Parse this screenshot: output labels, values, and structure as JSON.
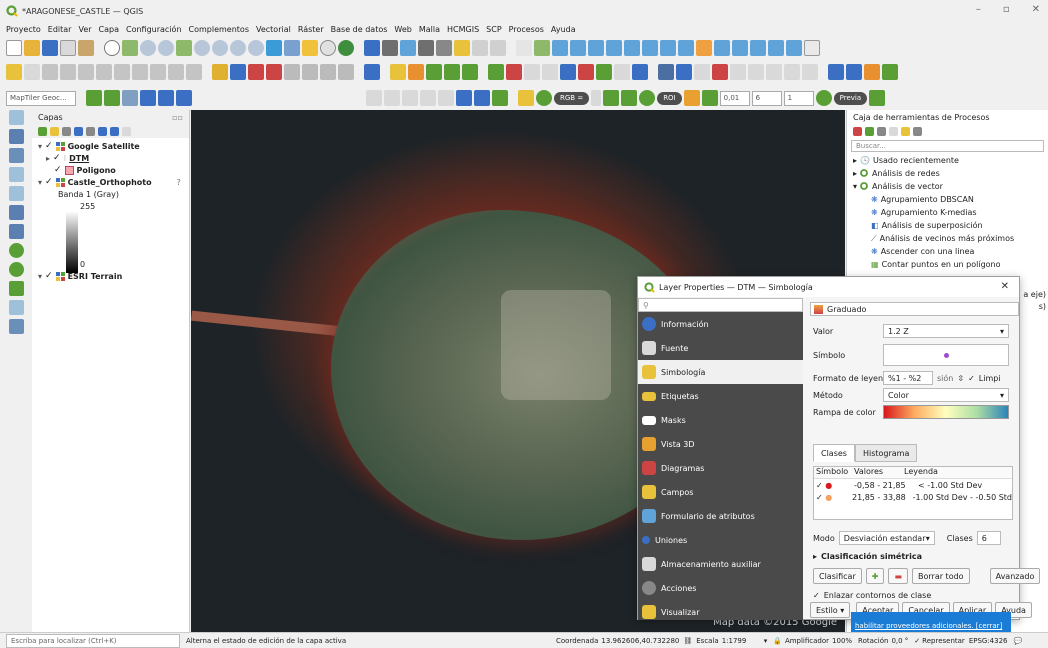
{
  "window": {
    "title": "*ARAGONESE_CASTLE — QGIS",
    "controls": [
      "–",
      "▫",
      "✕"
    ]
  },
  "menu": [
    "Proyecto",
    "Editar",
    "Ver",
    "Capa",
    "Configuración",
    "Complementos",
    "Vectorial",
    "Ráster",
    "Base de datos",
    "Web",
    "Malla",
    "HCMGIS",
    "SCP",
    "Procesos",
    "Ayuda"
  ],
  "toolbar3": {
    "maptiler": "MapTiler Geoc...",
    "rgb": "RGB =",
    "roi": "ROI",
    "dist1": "0,01",
    "dist2": "6",
    "dist3": "1",
    "preview": "Previa"
  },
  "layers": {
    "title": "Capas",
    "items": [
      {
        "name": "Google Satellite",
        "bold": true
      },
      {
        "name": "DTM",
        "bold": true
      },
      {
        "name": "Poligono",
        "bold": true
      },
      {
        "name": "Castle_Orthophoto",
        "bold": true
      },
      {
        "name": "Banda 1 (Gray)",
        "bold": false
      },
      {
        "name": "255",
        "bold": false
      },
      {
        "name": "0",
        "bold": false
      },
      {
        "name": "ESRI Terrain",
        "bold": true
      }
    ]
  },
  "processing": {
    "title": "Caja de herramientas de Procesos",
    "search": "Buscar...",
    "items": [
      {
        "label": "Usado recientemente",
        "indent": 0
      },
      {
        "label": "Análisis de redes",
        "indent": 0
      },
      {
        "label": "Análisis de vector",
        "indent": 0
      },
      {
        "label": "Agrupamiento DBSCAN",
        "indent": 1
      },
      {
        "label": "Agrupamiento K-medias",
        "indent": 1
      },
      {
        "label": "Análisis de superposición",
        "indent": 1
      },
      {
        "label": "Análisis de vecinos más próximos",
        "indent": 1
      },
      {
        "label": "Ascender con una linea",
        "indent": 1
      },
      {
        "label": "Contar puntos en un polígono",
        "indent": 1
      }
    ],
    "peek1": "a eje)",
    "peek2": "s)"
  },
  "map": {
    "attribution": "Map data ©2015 Google",
    "provider_notice": "habilitar proveedores adicionales. [cerrar]"
  },
  "dialog": {
    "title": "Layer Properties — DTM — Simbología",
    "nav": [
      "Información",
      "Fuente",
      "Simbología",
      "Etiquetas",
      "Masks",
      "Vista 3D",
      "Diagramas",
      "Campos",
      "Formulario de atributos",
      "Uniones",
      "Almacenamiento auxiliar",
      "Acciones",
      "Visualizar"
    ],
    "renderer": "Graduado",
    "valor_label": "Valor",
    "valor": "1.2 Z",
    "simbolo_label": "Símbolo",
    "formato_label": "Formato de leyenda",
    "formato": "%1 - %2",
    "precision": "sión",
    "limpiar": "Limpi",
    "metodo_label": "Método",
    "metodo": "Color",
    "rampa_label": "Rampa de color",
    "tabs": [
      "Clases",
      "Histograma"
    ],
    "cols": [
      "Símbolo",
      "Valores",
      "Leyenda"
    ],
    "classes": [
      {
        "valores": "-0,58 - 21,85",
        "leyenda": "< -1.00 Std Dev",
        "color": "#d7191c"
      },
      {
        "valores": "21,85 - 33,88",
        "leyenda": "-1.00 Std Dev - -0.50 Std",
        "color": "#f4a261"
      }
    ],
    "modo_label": "Modo",
    "modo": "Desviación estandar",
    "clases_label": "Clases",
    "clases": "6",
    "sym_label": "Clasificación simétrica",
    "btn_clasificar": "Clasificar",
    "btn_borrar": "Borrar todo",
    "btn_avanzado": "Avanzado",
    "enlazar": "Enlazar contornos de clase",
    "estilo": "Estilo",
    "btn_aceptar": "Aceptar",
    "btn_cancelar": "Cancelar",
    "btn_aplicar": "Aplicar",
    "btn_ayuda": "Ayuda"
  },
  "status": {
    "locate": "Escriba para localizar (Ctrl+K)",
    "message": "Alterna el estado de edición de la capa activa",
    "coord_label": "Coordenada",
    "coord": "13.962606,40.732280",
    "scale_label": "Escala",
    "scale": "1:1799",
    "magnifier_label": "Amplificador",
    "magnifier": "100%",
    "rotation_label": "Rotación",
    "rotation": "0,0 °",
    "render": "Representar",
    "crs": "EPSG:4326"
  },
  "colors": {
    "accent": "#1b7cd6",
    "nav_bg": "#4a4a4a",
    "qgis_green": "#5a9e36"
  }
}
